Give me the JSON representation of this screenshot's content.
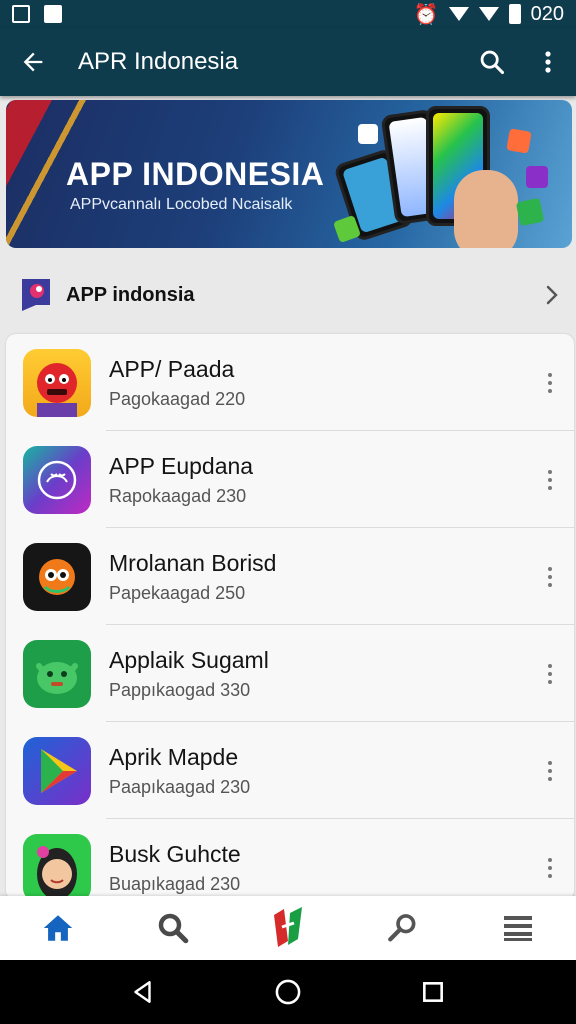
{
  "status_bar": {
    "time": "020"
  },
  "app_bar": {
    "title": "APR Indonesia"
  },
  "banner": {
    "title": "APP INDONESIA",
    "subtitle": "APPvcannalı Locobed Ncaisalk"
  },
  "section": {
    "title": "APP indonsia"
  },
  "apps": [
    {
      "name": "APP/ Paada",
      "sub": "Pagokaagad 220"
    },
    {
      "name": "APP Eupdana",
      "sub": "Rapokaagad 230"
    },
    {
      "name": "Mrolanan Borisd",
      "sub": "Papekaagad 250"
    },
    {
      "name": "Applaik Sugaml",
      "sub": "Pappıkaogad 330"
    },
    {
      "name": "Aprik Mapde",
      "sub": "Paapıkaagad 230"
    },
    {
      "name": "Busk Guhcte",
      "sub": "Buapıkagad 230"
    }
  ],
  "colors": {
    "app_bar": "#0f3c4c",
    "accent_blue": "#1565c0"
  }
}
